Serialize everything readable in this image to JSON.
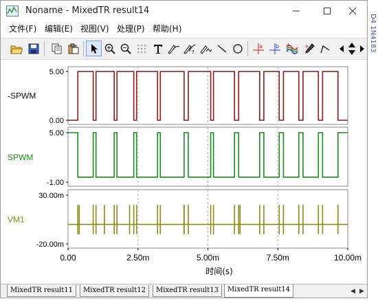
{
  "window": {
    "title": "Noname - MixedTR result14",
    "controls": [
      "minimize",
      "maximize",
      "close"
    ]
  },
  "menu": [
    {
      "label": "文件(F)"
    },
    {
      "label": "编辑(E)"
    },
    {
      "label": "视图(V)"
    },
    {
      "label": "处理(P)"
    },
    {
      "label": "帮助(H)"
    }
  ],
  "toolbar": {
    "buttons": [
      "open-folder-icon",
      "save-icon",
      "copy-icon",
      "paste-icon",
      "pointer-icon",
      "zoom-in-icon",
      "zoom-out-icon",
      "grid-select-icon",
      "text-tool-icon",
      "cursor-a-icon",
      "cursor-b-icon",
      "curve-icon",
      "line-tool-icon",
      "ellipse-tool-icon",
      "cursor-a-marker-icon",
      "cursor-b-marker-icon",
      "add-curve-icon",
      "marker-pen-icon",
      "pointer-marker-icon",
      "scroll-updown-icon"
    ]
  },
  "plots": [
    {
      "name": "-SPWM",
      "color": "#8b1a1a",
      "ytick_top": "5.00",
      "ytick_bottom": "0.00",
      "ylim": [
        0,
        5
      ]
    },
    {
      "name": "SPWM",
      "color": "#1a8a1a",
      "ytick_top": "5.00",
      "ytick_bottom": "-1.00",
      "ylim": [
        -1,
        5
      ]
    },
    {
      "name": "VM1",
      "color": "#8a8a14",
      "ytick_top": "30.00m",
      "ytick_bottom": "-20.00m",
      "ylim": [
        -0.02,
        0.03
      ]
    }
  ],
  "chart_data": {
    "type": "line",
    "xlabel": "时间(s)",
    "xticks": [
      "0.00",
      "2.50m",
      "5.00m",
      "7.50m",
      "10.00m"
    ],
    "xlim": [
      0,
      0.01
    ],
    "series": [
      {
        "name": "-SPWM",
        "edges_ms": [
          0.35,
          0.9,
          1.0,
          1.65,
          1.75,
          2.35,
          2.45,
          3.2,
          3.3,
          4.15,
          4.3,
          5.1,
          5.2,
          5.95,
          6.1,
          6.85,
          7.0,
          7.55,
          7.7,
          8.25,
          8.4,
          8.95,
          9.1,
          9.65
        ],
        "low": 0.0,
        "high": 5.0,
        "initial": "low"
      },
      {
        "name": "SPWM",
        "edges_ms": [
          0.35,
          0.9,
          1.0,
          1.65,
          1.75,
          2.35,
          2.45,
          3.2,
          3.3,
          4.15,
          4.3,
          5.1,
          5.2,
          5.95,
          6.1,
          6.85,
          7.0,
          7.55,
          7.7,
          8.25,
          8.4,
          8.95,
          9.1,
          9.65
        ],
        "low": -0.4,
        "high": 5.0,
        "initial": "high"
      },
      {
        "name": "VM1",
        "baseline": 0.0,
        "spikes_ms": [
          0.35,
          0.4,
          0.9,
          1.0,
          1.3,
          1.65,
          1.75,
          2.2,
          2.35,
          2.45,
          3.2,
          3.3,
          4.15,
          4.3,
          4.15,
          5.1,
          5.2,
          5.95,
          6.1,
          6.15,
          6.85,
          7.0,
          7.55,
          7.7,
          8.25,
          8.4,
          8.95,
          9.1,
          9.65
        ],
        "spike_high": 0.02,
        "spike_low": -0.01
      }
    ]
  },
  "tabs": [
    {
      "label": "MixedTR result11",
      "active": false
    },
    {
      "label": "MixedTR result12",
      "active": false
    },
    {
      "label": "MixedTR result13",
      "active": false
    },
    {
      "label": "MixedTR result14",
      "active": true
    }
  ],
  "side": {
    "text": "D4 1N4183"
  }
}
